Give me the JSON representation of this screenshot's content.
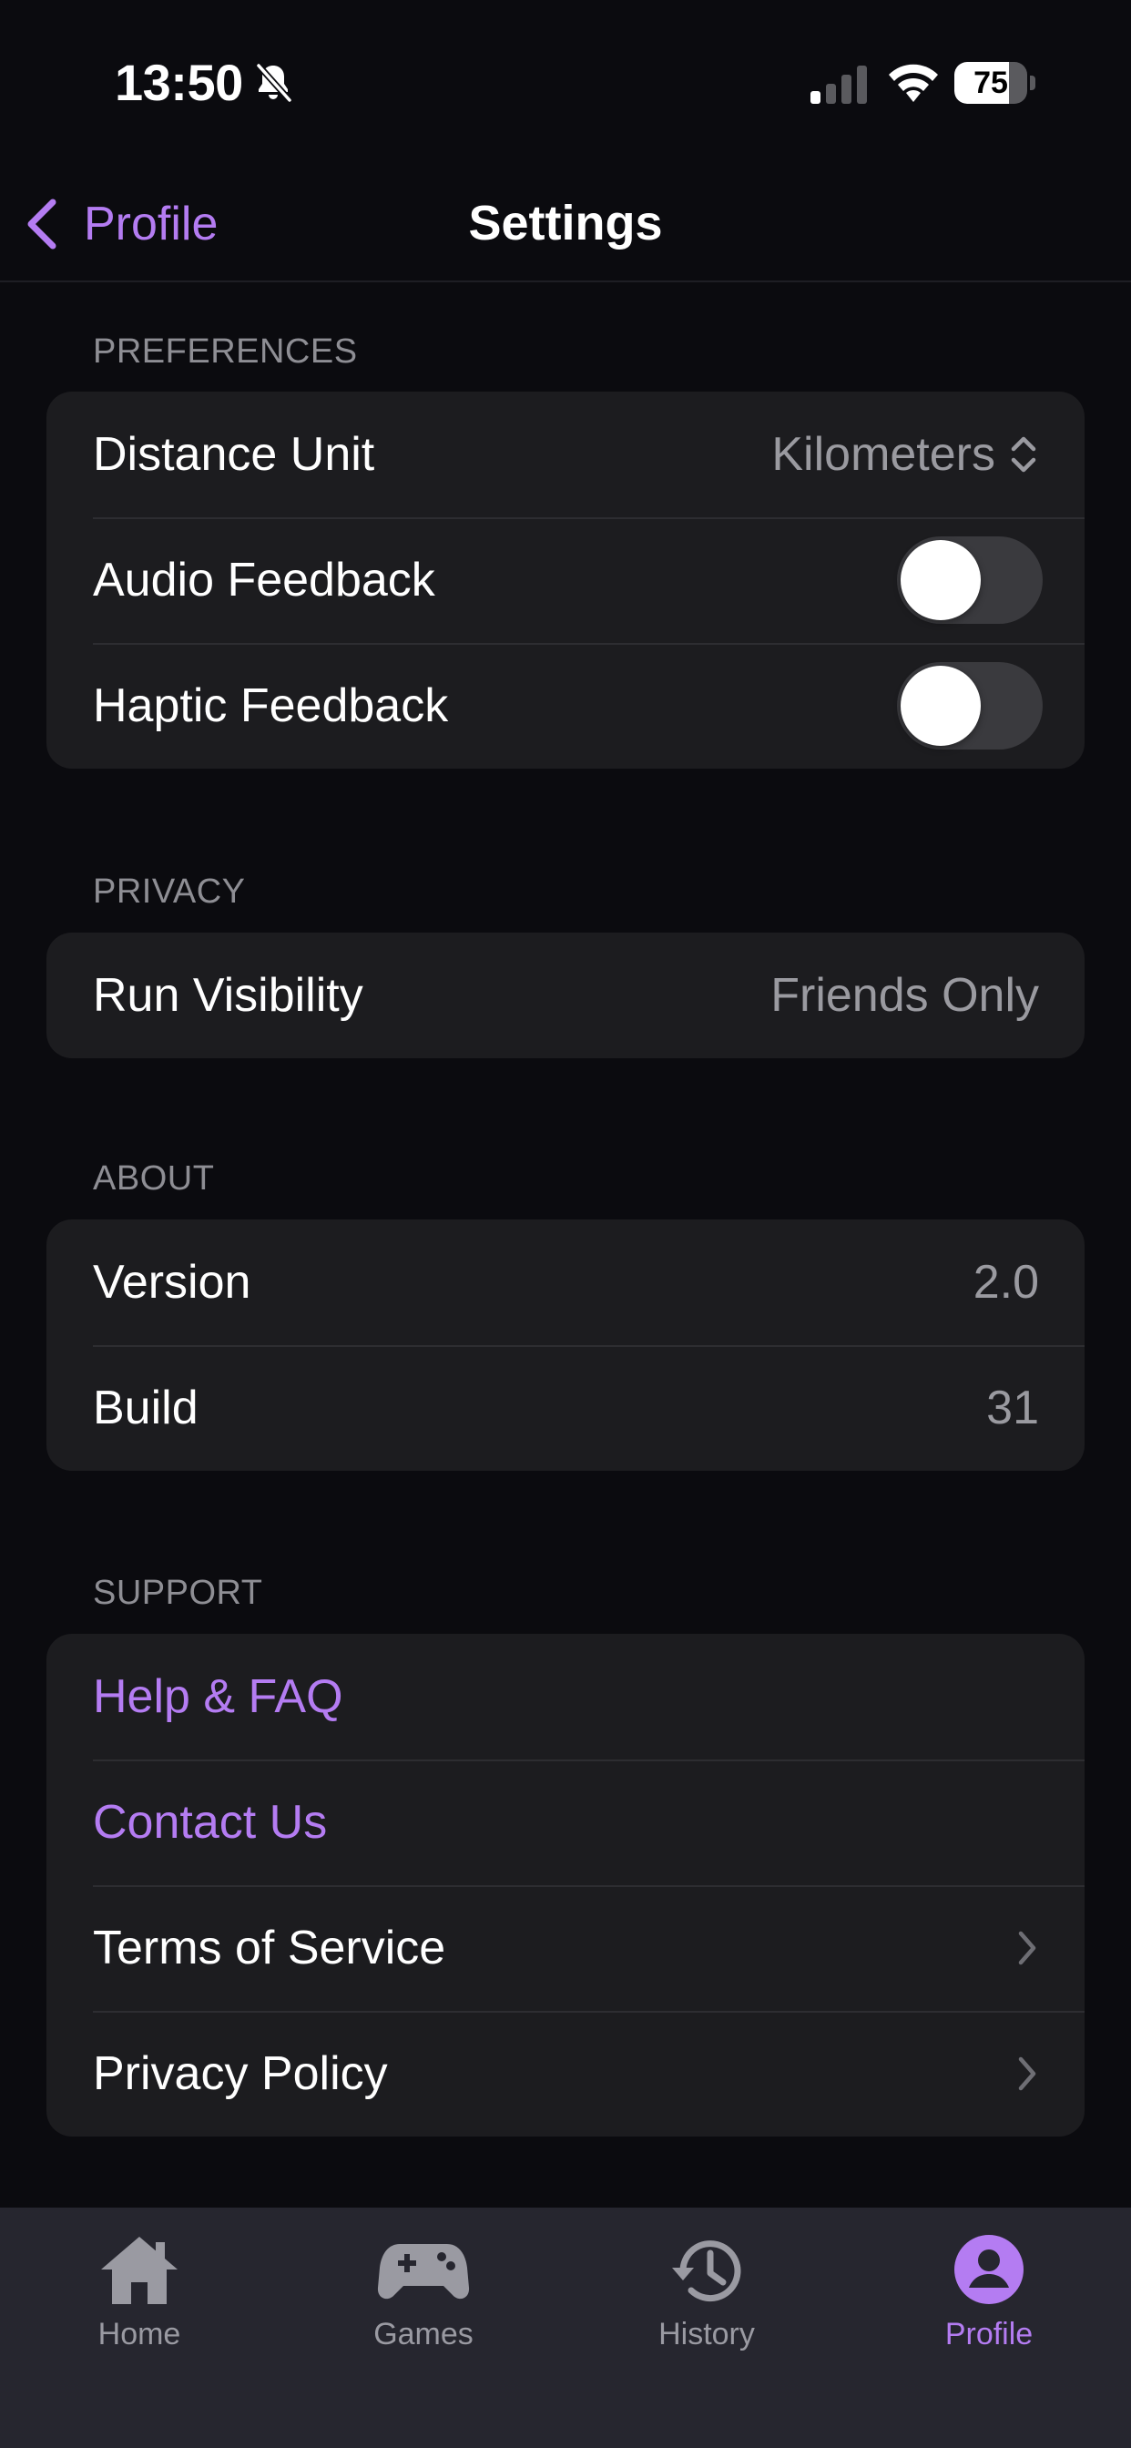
{
  "status_bar": {
    "time": "13:50",
    "battery_percent": 75,
    "battery_text": "75",
    "icons": [
      "bell-slash-icon",
      "signal-icon",
      "wifi-icon",
      "battery-icon"
    ]
  },
  "nav": {
    "back_label": "Profile",
    "title": "Settings"
  },
  "sections": {
    "preferences": {
      "header": "PREFERENCES",
      "distance_unit": {
        "label": "Distance Unit",
        "value": "Kilometers"
      },
      "audio_feedback": {
        "label": "Audio Feedback",
        "on": false
      },
      "haptic_feedback": {
        "label": "Haptic Feedback",
        "on": false
      }
    },
    "privacy": {
      "header": "PRIVACY",
      "run_visibility": {
        "label": "Run Visibility",
        "value": "Friends Only"
      }
    },
    "about": {
      "header": "ABOUT",
      "version": {
        "label": "Version",
        "value": "2.0"
      },
      "build": {
        "label": "Build",
        "value": "31"
      }
    },
    "support": {
      "header": "SUPPORT",
      "help": {
        "label": "Help & FAQ"
      },
      "contact": {
        "label": "Contact Us"
      },
      "terms": {
        "label": "Terms of Service"
      },
      "privacy_policy": {
        "label": "Privacy Policy"
      }
    }
  },
  "tab_bar": {
    "tabs": [
      {
        "label": "Home",
        "icon": "house-icon",
        "active": false
      },
      {
        "label": "Games",
        "icon": "gamepad-icon",
        "active": false
      },
      {
        "label": "History",
        "icon": "history-icon",
        "active": false
      },
      {
        "label": "Profile",
        "icon": "person-circle-icon",
        "active": true
      }
    ]
  },
  "colors": {
    "accent": "#b47cf2",
    "background": "#0b0b0f",
    "card": "#1c1c1f",
    "tab_bar": "#26262f",
    "secondary_text": "#9a9aa0"
  }
}
